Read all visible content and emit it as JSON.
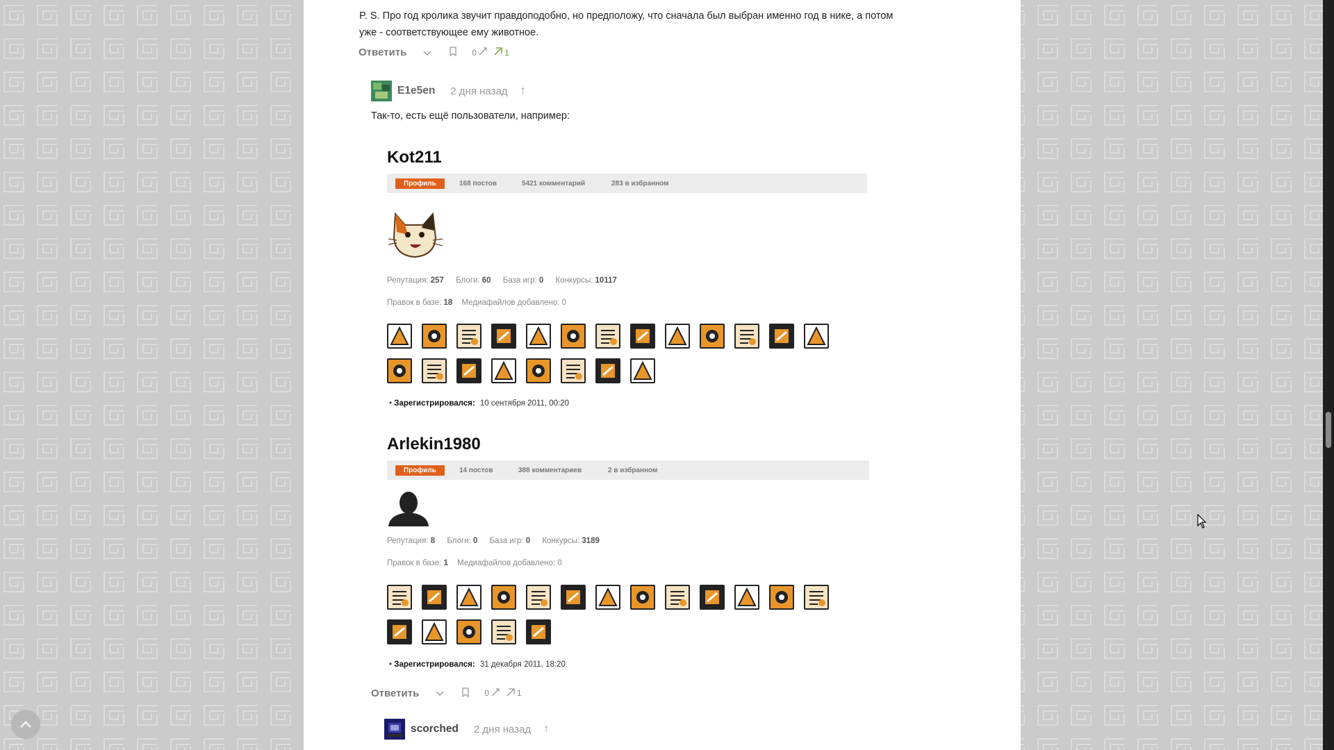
{
  "top_comment": {
    "text_line1": "P. S. Про год кролика звучит правдоподобно, но предположу, что сначала был выбран именно год в нике, а потом",
    "text_line2": "уже - соответствующее ему животное.",
    "reply_label": "Ответить",
    "votes_left": "0",
    "votes_right": "1"
  },
  "reply_comment": {
    "author": "E1e5en",
    "time": "2 дня назад",
    "text": "Так-то, есть ещё пользователи, например:",
    "reply_label": "Ответить",
    "votes_left": "0",
    "votes_right": "1"
  },
  "profiles": [
    {
      "name": "Kot211",
      "tab_profile": "Профиль",
      "tab_posts": "168 постов",
      "tab_comments": "5421 комментарий",
      "tab_fav": "283 в избранном",
      "rep_label": "Репутация:",
      "rep": "257",
      "blogs_label": "Блоги:",
      "blogs": "60",
      "games_label": "База игр:",
      "games": "0",
      "contests_label": "Конкурсы:",
      "contests": "10117",
      "edits_label": "Правок в базе:",
      "edits": "18",
      "media_label": "Медиафайлов добавлено:",
      "media": "0",
      "reg_label": "Зарегистрировался:",
      "reg": "10 сентября 2011, 00:20"
    },
    {
      "name": "Arlekin1980",
      "tab_profile": "Профиль",
      "tab_posts": "14 постов",
      "tab_comments": "388 комментариев",
      "tab_fav": "2 в избранном",
      "rep_label": "Репутация:",
      "rep": "8",
      "blogs_label": "Блоги:",
      "blogs": "0",
      "games_label": "База игр:",
      "games": "0",
      "contests_label": "Конкурсы:",
      "contests": "3189",
      "edits_label": "Правок в базе:",
      "edits": "1",
      "media_label": "Медиафайлов добавлено:",
      "media": "0",
      "reg_label": "Зарегистрировался:",
      "reg": "31 декабря 2011, 18:20"
    }
  ],
  "next_comment": {
    "author": "scorched",
    "time": "2 дня назад"
  },
  "colors": {
    "accent": "#e0601a",
    "badge_orange": "#e8962a",
    "green": "#6a9a2a"
  }
}
